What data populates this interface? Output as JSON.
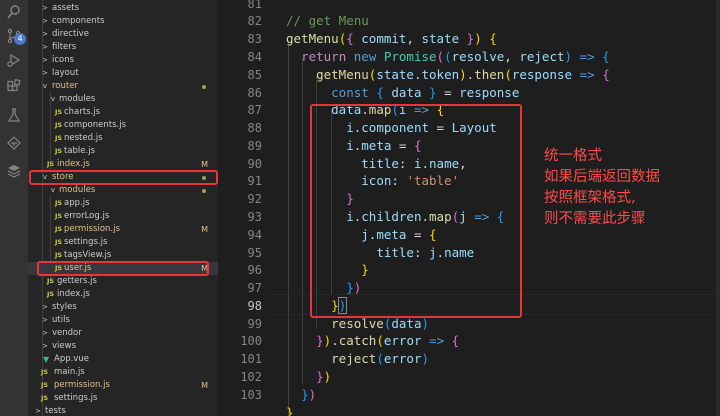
{
  "activity_bar": {
    "icons": [
      "search-icon",
      "source-control-icon",
      "run-debug-icon",
      "extensions-icon",
      "test-flask-icon",
      "git-lens-icon",
      "database-icon"
    ],
    "source_control_badge": "4"
  },
  "explorer": {
    "items": [
      {
        "label": "assets",
        "kind": "folder",
        "expanded": false
      },
      {
        "label": "components",
        "kind": "folder",
        "expanded": false
      },
      {
        "label": "directive",
        "kind": "folder",
        "expanded": false
      },
      {
        "label": "filters",
        "kind": "folder",
        "expanded": false
      },
      {
        "label": "icons",
        "kind": "folder",
        "expanded": false
      },
      {
        "label": "layout",
        "kind": "folder",
        "expanded": false
      },
      {
        "label": "router",
        "kind": "folder",
        "expanded": true
      },
      {
        "label": "modules",
        "kind": "folder",
        "expanded": true
      },
      {
        "label": "charts.js",
        "kind": "js"
      },
      {
        "label": "components.js",
        "kind": "js"
      },
      {
        "label": "nested.js",
        "kind": "js"
      },
      {
        "label": "table.js",
        "kind": "js"
      },
      {
        "label": "index.js",
        "kind": "js",
        "status": "M"
      },
      {
        "label": "store",
        "kind": "folder",
        "expanded": true
      },
      {
        "label": "modules",
        "kind": "folder",
        "expanded": true
      },
      {
        "label": "app.js",
        "kind": "js"
      },
      {
        "label": "errorLog.js",
        "kind": "js"
      },
      {
        "label": "permission.js",
        "kind": "js",
        "status": "M"
      },
      {
        "label": "settings.js",
        "kind": "js"
      },
      {
        "label": "tagsView.js",
        "kind": "js"
      },
      {
        "label": "user.js",
        "kind": "js",
        "status": "M"
      },
      {
        "label": "getters.js",
        "kind": "js"
      },
      {
        "label": "index.js",
        "kind": "js"
      },
      {
        "label": "styles",
        "kind": "folder",
        "expanded": false
      },
      {
        "label": "utils",
        "kind": "folder",
        "expanded": false
      },
      {
        "label": "vendor",
        "kind": "folder",
        "expanded": false
      },
      {
        "label": "views",
        "kind": "folder",
        "expanded": false
      },
      {
        "label": "App.vue",
        "kind": "vue"
      },
      {
        "label": "main.js",
        "kind": "js"
      },
      {
        "label": "permission.js",
        "kind": "js",
        "status": "M"
      },
      {
        "label": "settings.js",
        "kind": "js"
      },
      {
        "label": "tests",
        "kind": "folder",
        "expanded": false
      }
    ]
  },
  "editor": {
    "line_numbers": [
      "81",
      "82",
      "83",
      "84",
      "85",
      "86",
      "87",
      "88",
      "89",
      "90",
      "91",
      "92",
      "93",
      "94",
      "95",
      "96",
      "97",
      "98",
      "99",
      "100",
      "101",
      "102",
      "103"
    ],
    "current_line": "98"
  },
  "annotation": {
    "lines": [
      "统一格式",
      "如果后端返回数据",
      "按照框架格式,",
      "则不需要此步骤"
    ],
    "color": "#ff4a4a"
  },
  "colors": {
    "highlight_box": "#e8343b",
    "git_modified": "#e2c08d"
  }
}
